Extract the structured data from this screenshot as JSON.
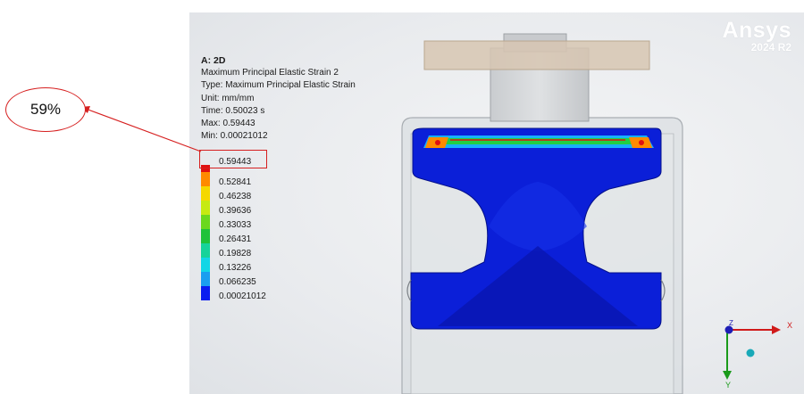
{
  "result": {
    "title": "A: 2D",
    "lines": [
      "Maximum Principal Elastic Strain 2",
      "Type: Maximum Principal Elastic Strain",
      "Unit: mm/mm",
      "Time: 0.50023 s",
      "Max: 0.59443",
      "Min: 0.00021012"
    ]
  },
  "legend": {
    "entries": [
      {
        "label": "0.59443",
        "color": "#e01010"
      },
      {
        "label": "0.52841",
        "color": "#ff8a00"
      },
      {
        "label": "0.46238",
        "color": "#f5d800"
      },
      {
        "label": "0.39636",
        "color": "#c6ea12"
      },
      {
        "label": "0.33033",
        "color": "#6bd81e"
      },
      {
        "label": "0.26431",
        "color": "#1fc23a"
      },
      {
        "label": "0.19828",
        "color": "#16d39a"
      },
      {
        "label": "0.13226",
        "color": "#11d6e6"
      },
      {
        "label": "0.066235",
        "color": "#1a9ef0"
      },
      {
        "label": "0.00021012",
        "color": "#0a1cf0"
      }
    ]
  },
  "logo": {
    "brand": "Ansys",
    "version": "2024 R2"
  },
  "axes": {
    "x": "X",
    "y": "Y",
    "z": "Z"
  },
  "annotation": {
    "callout": "59%"
  }
}
